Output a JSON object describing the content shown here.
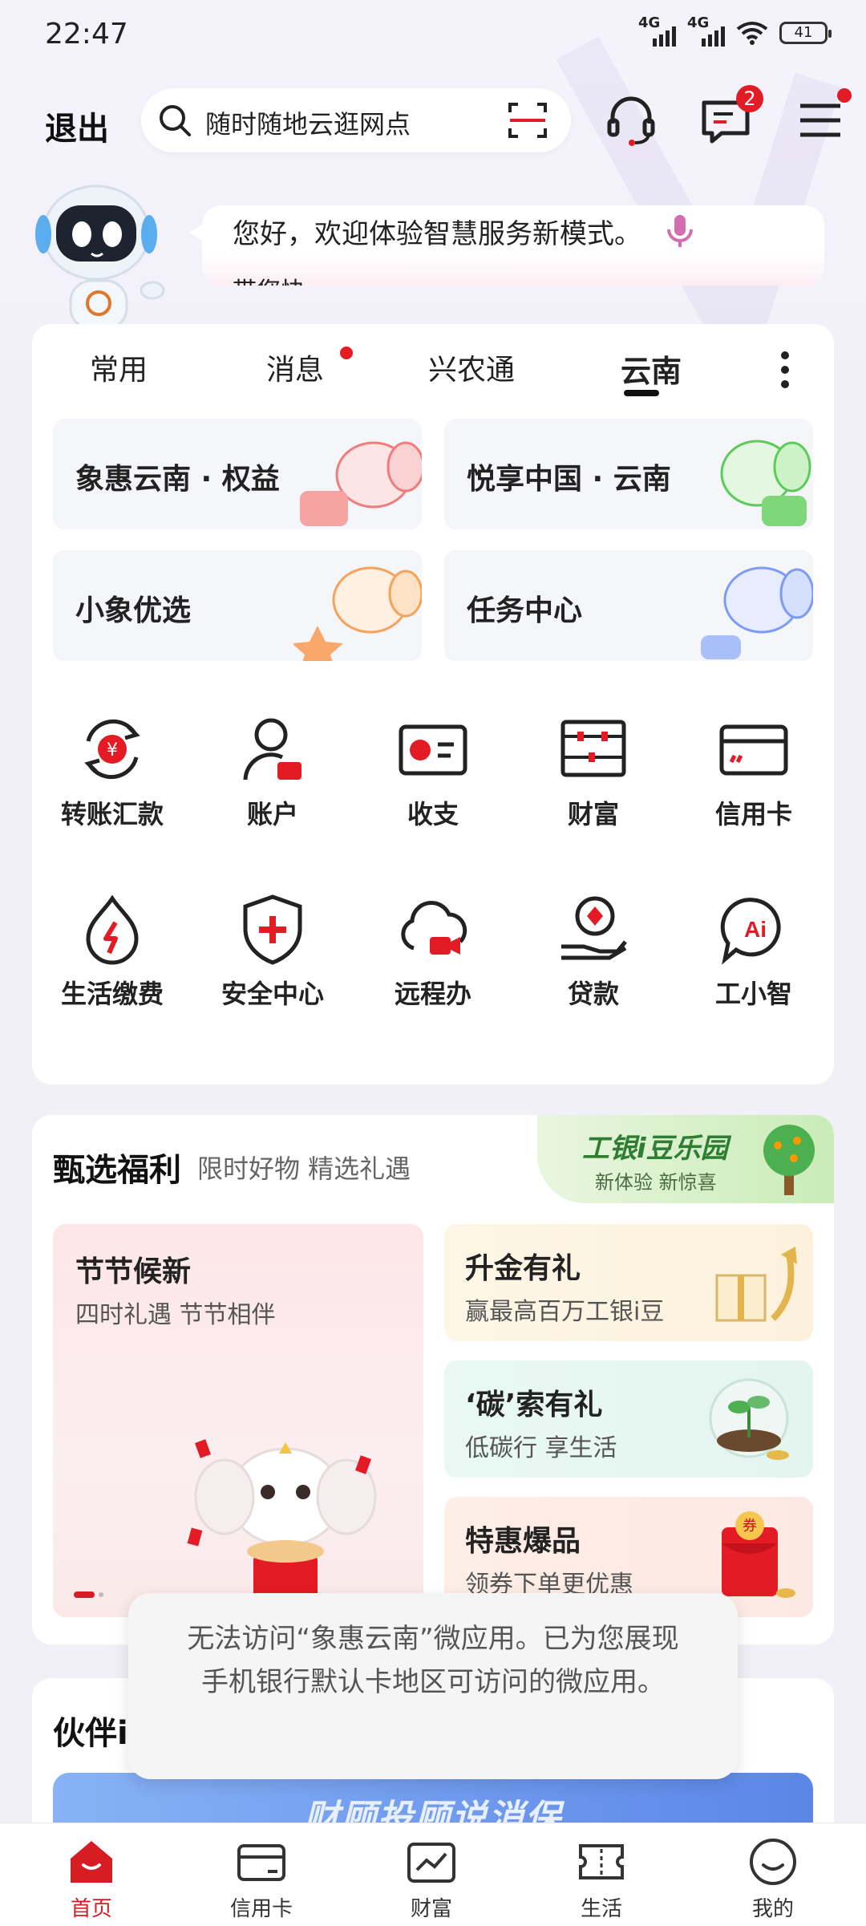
{
  "status_bar": {
    "time": "22:47",
    "net1": "4G",
    "net2": "4G",
    "battery": "41"
  },
  "header": {
    "exit_label": "退出",
    "search_placeholder": "随时随地云逛网点",
    "message_badge": "2"
  },
  "assistant": {
    "greeting": "您好，欢迎体验智慧服务新模式。",
    "second_line": "带您快"
  },
  "tabs": [
    {
      "label": "常用"
    },
    {
      "label": "消息"
    },
    {
      "label": "兴农通"
    },
    {
      "label": "云南"
    }
  ],
  "promos": [
    {
      "label": "象惠云南 · 权益"
    },
    {
      "label": "悦享中国 · 云南"
    },
    {
      "label": "小象优选"
    },
    {
      "label": "任务中心"
    }
  ],
  "grid": [
    {
      "label": "转账汇款",
      "icon": "transfer-icon"
    },
    {
      "label": "账户",
      "icon": "account-icon"
    },
    {
      "label": "收支",
      "icon": "income-expense-icon"
    },
    {
      "label": "财富",
      "icon": "wealth-icon"
    },
    {
      "label": "信用卡",
      "icon": "credit-card-icon"
    },
    {
      "label": "生活缴费",
      "icon": "bill-payment-icon"
    },
    {
      "label": "安全中心",
      "icon": "security-shield-icon"
    },
    {
      "label": "远程办",
      "icon": "remote-service-icon"
    },
    {
      "label": "贷款",
      "icon": "loan-icon"
    },
    {
      "label": "工小智",
      "icon": "ai-assistant-icon"
    }
  ],
  "welfare": {
    "title": "甄选福利",
    "subtitle": "限时好物 精选礼遇",
    "garden_title": "工银i豆乐园",
    "garden_sub": "新体验 新惊喜",
    "big_tile": {
      "title": "节节候新",
      "subtitle": "四时礼遇 节节相伴"
    },
    "tiles": [
      {
        "title": "升金有礼",
        "subtitle": "赢最高百万工银i豆"
      },
      {
        "title": "‘碳’索有礼",
        "subtitle": "低碳行 享生活"
      },
      {
        "title": "特惠爆品",
        "subtitle": "领券下单更优惠"
      }
    ]
  },
  "partner": {
    "title": "伙伴i",
    "banner_text": "财顾投顾说消保"
  },
  "toast": {
    "message": "无法访问“象惠云南”微应用。已为您展现手机银行默认卡地区可访问的微应用。"
  },
  "bottom_nav": [
    {
      "label": "首页"
    },
    {
      "label": "信用卡"
    },
    {
      "label": "财富"
    },
    {
      "label": "生活"
    },
    {
      "label": "我的"
    }
  ],
  "colors": {
    "accent": "#d71d24",
    "badge": "#e31b24"
  }
}
